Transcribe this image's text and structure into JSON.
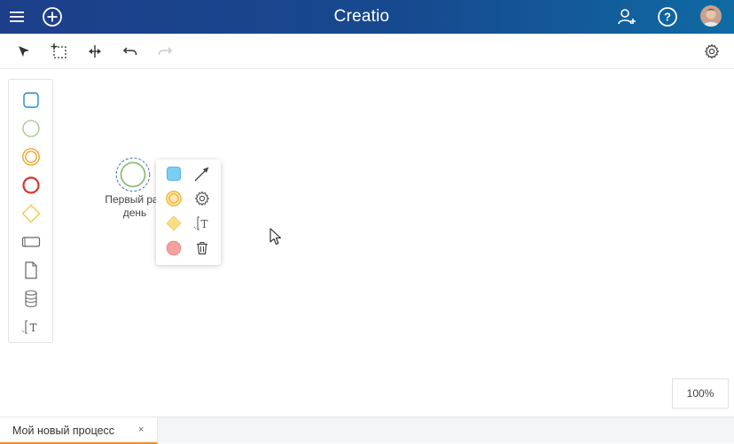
{
  "header": {
    "brand": "Creatio",
    "menu_icon": "hamburger-menu-icon",
    "add_icon": "plus-circle-icon",
    "add_user_icon": "add-user-icon",
    "help_icon": "help-circle-icon",
    "avatar_icon": "user-avatar",
    "background_color": "#1d3f8a"
  },
  "toolbar": {
    "tools": [
      {
        "name": "select-tool",
        "icon": "arrow-pointer-icon"
      },
      {
        "name": "area-select-tool",
        "icon": "lasso-select-icon"
      },
      {
        "name": "space-tool",
        "icon": "space-tool-icon"
      },
      {
        "name": "undo-button",
        "icon": "undo-icon"
      },
      {
        "name": "redo-button",
        "icon": "redo-icon",
        "enabled": false
      }
    ],
    "settings_icon": "gear-icon"
  },
  "palette": {
    "items": [
      {
        "name": "task",
        "icon": "rounded-square-icon",
        "color": "#1e8ad6"
      },
      {
        "name": "start-event",
        "icon": "circle-icon",
        "color": "#8fbf75"
      },
      {
        "name": "intermediate-event",
        "icon": "double-circle-icon",
        "color": "#f0a42f"
      },
      {
        "name": "end-event",
        "icon": "thick-circle-icon",
        "color": "#d9342b"
      },
      {
        "name": "gateway",
        "icon": "diamond-icon",
        "color": "#f3c64e"
      },
      {
        "name": "subprocess",
        "icon": "rectangle-icon",
        "color": "#666666"
      },
      {
        "name": "data-object",
        "icon": "document-icon",
        "color": "#666666"
      },
      {
        "name": "data-store",
        "icon": "database-icon",
        "color": "#666666"
      },
      {
        "name": "annotation",
        "icon": "annotation-icon",
        "color": "#666666"
      }
    ]
  },
  "diagram": {
    "start_element": {
      "label": "Первый раб\nдень",
      "color": "#8fbf75"
    },
    "context_menu": {
      "items": [
        {
          "name": "append-task",
          "icon": "task-fill-icon",
          "color": "#7ccdf4"
        },
        {
          "name": "connect",
          "icon": "arrow-connect-icon"
        },
        {
          "name": "append-intermediate-event",
          "icon": "intermediate-event-icon",
          "color": "#f5b43a"
        },
        {
          "name": "element-settings",
          "icon": "gear-icon"
        },
        {
          "name": "append-gateway",
          "icon": "gateway-fill-icon",
          "color": "#f5d06a"
        },
        {
          "name": "add-annotation",
          "icon": "annotation-icon"
        },
        {
          "name": "append-end-event",
          "icon": "end-event-fill-icon",
          "color": "#f3a0a0"
        },
        {
          "name": "delete",
          "icon": "trash-icon"
        }
      ]
    },
    "zoom": "100%"
  },
  "tabs": [
    {
      "label": "Мой новый процесс",
      "close": "×",
      "active": true,
      "accent_color": "#f28c28"
    }
  ]
}
